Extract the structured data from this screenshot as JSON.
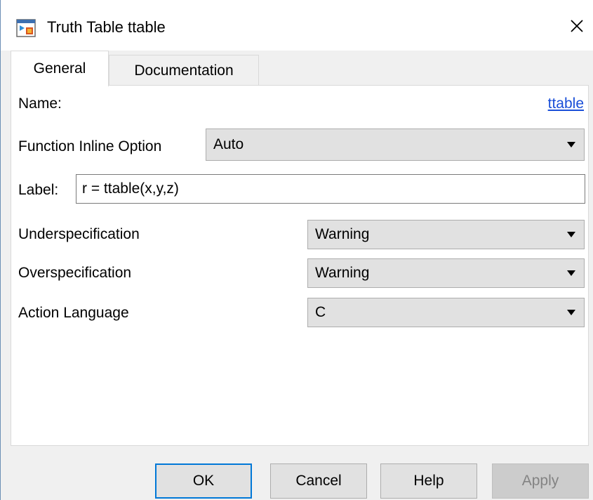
{
  "window": {
    "title": "Truth Table ttable",
    "icons": {
      "app": "truth-table-icon",
      "close": "close-icon"
    }
  },
  "tabs": [
    {
      "label": "General",
      "active": true
    },
    {
      "label": "Documentation",
      "active": false
    }
  ],
  "general": {
    "name_label": "Name:",
    "name_value": "ttable",
    "inline_label": "Function Inline Option",
    "inline_value": "Auto",
    "label_label": "Label:",
    "label_value": "r = ttable(x,y,z)",
    "underspec_label": "Underspecification",
    "underspec_value": "Warning",
    "overspec_label": "Overspecification",
    "overspec_value": "Warning",
    "action_lang_label": "Action Language",
    "action_lang_value": "C"
  },
  "buttons": {
    "ok": "OK",
    "cancel": "Cancel",
    "help": "Help",
    "apply": "Apply"
  },
  "colors": {
    "link": "#1a4fd8",
    "default_button_border": "#0078d7"
  }
}
